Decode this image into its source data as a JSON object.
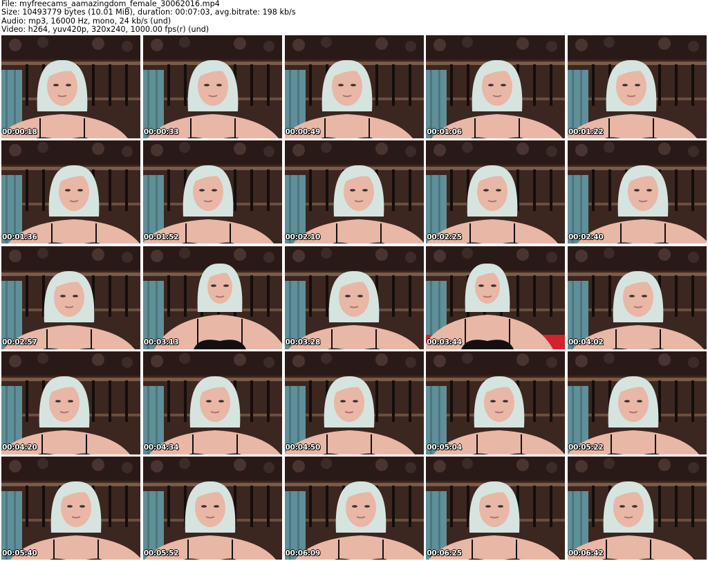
{
  "info": {
    "file": "File: myfreecams_aamazingdom_female_30062016.mp4",
    "size": "Size: 10493779 bytes (10.01 MiB), duration: 00:07:03, avg.bitrate: 198 kb/s",
    "audio": "Audio: mp3, 16000 Hz, mono, 24 kb/s (und)",
    "video": "Video: h264, yuv420p, 320x240, 1000.00 fps(r) (und)"
  },
  "thumbnails": [
    {
      "timestamp": "00:00:18",
      "scene": "leaning-forward"
    },
    {
      "timestamp": "00:00:33",
      "scene": "leaning-forward"
    },
    {
      "timestamp": "00:00:49",
      "scene": "leaning-forward"
    },
    {
      "timestamp": "00:01:06",
      "scene": "leaning-forward"
    },
    {
      "timestamp": "00:01:22",
      "scene": "leaning-forward"
    },
    {
      "timestamp": "00:01:36",
      "scene": "leaning-forward"
    },
    {
      "timestamp": "00:01:52",
      "scene": "leaning-forward"
    },
    {
      "timestamp": "00:02:10",
      "scene": "leaning-forward"
    },
    {
      "timestamp": "00:02:25",
      "scene": "leaning-forward"
    },
    {
      "timestamp": "00:02:40",
      "scene": "leaning-forward"
    },
    {
      "timestamp": "00:02:57",
      "scene": "leaning-forward"
    },
    {
      "timestamp": "00:03:13",
      "scene": "sitting-upright"
    },
    {
      "timestamp": "00:03:28",
      "scene": "leaning-forward"
    },
    {
      "timestamp": "00:03:44",
      "scene": "sitting-upright-red"
    },
    {
      "timestamp": "00:04:02",
      "scene": "leaning-forward"
    },
    {
      "timestamp": "00:04:20",
      "scene": "leaning-forward"
    },
    {
      "timestamp": "00:04:34",
      "scene": "leaning-forward"
    },
    {
      "timestamp": "00:04:50",
      "scene": "leaning-forward"
    },
    {
      "timestamp": "00:05:04",
      "scene": "leaning-forward"
    },
    {
      "timestamp": "00:05:22",
      "scene": "leaning-forward"
    },
    {
      "timestamp": "00:05:40",
      "scene": "leaning-forward"
    },
    {
      "timestamp": "00:05:52",
      "scene": "leaning-forward"
    },
    {
      "timestamp": "00:06:09",
      "scene": "leaning-forward"
    },
    {
      "timestamp": "00:06:25",
      "scene": "leaning-forward"
    },
    {
      "timestamp": "00:06:42",
      "scene": "leaning-forward"
    }
  ],
  "colors": {
    "background": "#ffffff",
    "text": "#000000",
    "timestamp_text": "#ffffff",
    "timestamp_outline": "#000000",
    "wall": "#3b2620",
    "curtain_blue": "#5f8f98",
    "hair": "#d6e4df",
    "skin": "#e9b7a6",
    "top_black": "#121010",
    "red_accent": "#d2232a"
  }
}
